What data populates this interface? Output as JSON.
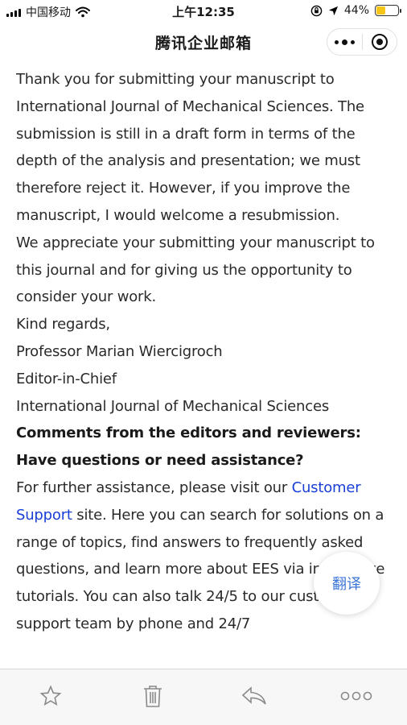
{
  "status_bar": {
    "carrier": "中国移动",
    "time": "上午12:35",
    "battery_percent": "44%",
    "battery_level": 0.44
  },
  "nav": {
    "title": "腾讯企业邮箱"
  },
  "email": {
    "paragraphs": [
      "Thank you for submitting your manuscript to International Journal of Mechanical Sciences. The submission is still in a draft form in terms of the depth of the analysis and presentation;  we must therefore reject it. However, if you improve the manuscript, I would welcome a resubmission.",
      "We appreciate your submitting your manuscript to this journal and for giving us the opportunity to consider your work.",
      "Kind regards,",
      "Professor Marian Wiercigroch",
      "Editor-in-Chief",
      "International Journal of Mechanical Sciences"
    ],
    "heading_comments": "Comments from the editors and reviewers:",
    "heading_questions": "Have questions or need assistance?",
    "assist_before": "For further assistance, please visit our ",
    "assist_link": "Customer Support",
    "assist_after": " site. Here you can search for solutions on a range of topics, find answers to frequently asked questions, and learn more about EES via interactive tutorials. You can also talk 24/5 to our customer support team by phone and 24/7"
  },
  "translate_label": "翻译",
  "toolbar": {
    "icons": [
      "star-icon",
      "trash-icon",
      "reply-icon",
      "more-icon"
    ]
  }
}
